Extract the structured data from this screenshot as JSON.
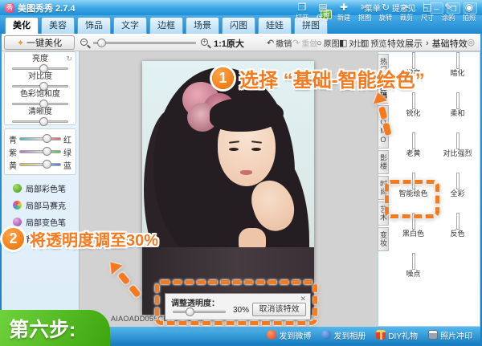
{
  "window": {
    "logo": "秀",
    "title": "美图秀秀 2.7.4",
    "menu": "菜单",
    "feedback": "提意见",
    "separator": "│",
    "minimize": "─",
    "maximize": "❐",
    "close": "✕"
  },
  "nav_tabs": {
    "items": [
      {
        "label": "美化",
        "active": true
      },
      {
        "label": "美容"
      },
      {
        "label": "饰品"
      },
      {
        "label": "文字"
      },
      {
        "label": "边框"
      },
      {
        "label": "场景"
      },
      {
        "label": "闪图"
      },
      {
        "label": "娃娃"
      },
      {
        "label": "拼图",
        "badge": "新"
      }
    ]
  },
  "main_toolbar": {
    "items": [
      {
        "label": "打开",
        "icon": "open-folder-icon",
        "glyph": "❒"
      },
      {
        "label": "保存",
        "icon": "save-icon",
        "glyph": "▤"
      },
      {
        "label": "新建",
        "icon": "new-file-icon",
        "glyph": "✚"
      },
      {
        "label": "抠图",
        "icon": "cutout-icon",
        "glyph": "✄"
      },
      {
        "label": "旋转",
        "icon": "rotate-icon",
        "glyph": "↻"
      },
      {
        "label": "裁剪",
        "icon": "crop-icon",
        "glyph": "✂"
      },
      {
        "label": "尺寸",
        "icon": "resize-icon",
        "glyph": "◱"
      },
      {
        "label": "涂鸦",
        "icon": "doodle-icon",
        "glyph": "✎"
      },
      {
        "label": "拍照",
        "icon": "camera-icon",
        "glyph": "◉"
      }
    ]
  },
  "edit_toolbar": {
    "auto_beautify": "一键美化",
    "zoom_label": "1:1原大",
    "undo": "撤销",
    "redo": "重做",
    "original": "原图",
    "compare": "对比",
    "preview": "预览"
  },
  "adjust_panel": {
    "sliders": [
      {
        "label": "亮度"
      },
      {
        "label": "对比度"
      },
      {
        "label": "色彩饱和度"
      },
      {
        "label": "清晰度"
      }
    ],
    "balance": [
      {
        "left": "青",
        "right": "红"
      },
      {
        "left": "紫",
        "right": "绿"
      },
      {
        "left": "黄",
        "right": "蓝"
      }
    ],
    "tools": [
      {
        "label": "局部彩色笔"
      },
      {
        "label": "局部马赛克"
      },
      {
        "label": "局部变色笔"
      },
      {
        "label": "背景虚化"
      }
    ]
  },
  "effects_panel": {
    "breadcrumb": {
      "root": "特效展示",
      "sep": "›",
      "current": "基础特效"
    },
    "categories": [
      {
        "label": "热门"
      },
      {
        "label": "基础",
        "selected": true
      },
      {
        "label": "LOMO"
      },
      {
        "label": "影楼"
      },
      {
        "label": "时尚"
      },
      {
        "label": "艺术"
      },
      {
        "label": "变妆"
      }
    ],
    "effects": [
      {
        "label": "增亮"
      },
      {
        "label": "暗化"
      },
      {
        "label": "锐化"
      },
      {
        "label": "柔和"
      },
      {
        "label": "老黄"
      },
      {
        "label": "对比强烈"
      },
      {
        "label": "智能绘色",
        "highlighted": true
      },
      {
        "label": "全彩"
      },
      {
        "label": "黑白色"
      },
      {
        "label": "反色"
      },
      {
        "label": "噪点"
      }
    ]
  },
  "transparency_dialog": {
    "title": "调整透明度：",
    "close": "✕",
    "percent": 30,
    "value_label": "30%",
    "cancel": "取消该特效"
  },
  "canvas": {
    "filename": "AIAOADD055CB1C1C1.jpg"
  },
  "annotations": {
    "step1_num": "1",
    "step1_text": "选择 “基础-智能绘色”",
    "step2_num": "2",
    "step2_text": "将透明度调至30%",
    "banner": "第六步:"
  },
  "status_bar": {
    "items": [
      {
        "label": "发到微博",
        "icon": "weibo-icon"
      },
      {
        "label": "发到相册",
        "icon": "album-icon"
      },
      {
        "label": "DIY礼物",
        "icon": "gift-icon"
      },
      {
        "label": "照片冲印",
        "icon": "printer-icon"
      }
    ]
  },
  "colors": {
    "annotation_orange": "#f47a20",
    "banner_green": "#46b41e",
    "frame_blue": "#2a9ade"
  }
}
